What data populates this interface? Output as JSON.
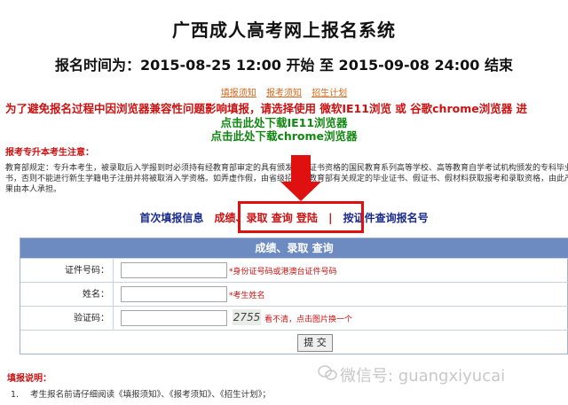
{
  "header": {
    "title": "广西成人高考网上报名系统",
    "time_text": "报名时间为：2015-08-25 12:00 开始  至  2015-09-08 24:00 结束"
  },
  "top_links": [
    "填报须知",
    "报考须知",
    "招生计划"
  ],
  "warning": "为了避免报名过程中因浏览器兼容性问题影响填报，请选择使用  微软IE11浏览  或  谷歌chrome浏览器  进",
  "download_ie": "点击此处下载IE11浏览器",
  "download_chrome": "点击此处下载chrome浏览器",
  "notice": {
    "heading": "报考专升本考生注意：",
    "lines": [
      "教育部规定：专升本考生，被录取后入学报到时必须持有经教育部审定的具有颁发学历证书资格的国民教育系列高等学校、高等教育自学考试机构颁发的专科毕业证书",
      "书，否则不能进行新生学籍电子注册并将被取消入学资格。如弄虚作假，由省级招办按教育部有关规定的毕业证书、假证书、假材料获取报考和录取资格，由此产生的",
      "果由本人承担。"
    ]
  },
  "nav": {
    "first_fill": "首次填报信息",
    "score_login": "成绩、录取  查询  登陆",
    "separator": "|",
    "by_id": "按证件查询报名号"
  },
  "form": {
    "header": "成绩、录取  查询",
    "id_label": "证件号码：",
    "id_hint": "*身份证号码或港澳台证件号码",
    "name_label": "姓名：",
    "name_hint": "*考生姓名",
    "captcha_label": "验证码：",
    "captcha_code": "2755",
    "captcha_hint": "看不清，点击图片换一个",
    "submit_label": "提 交"
  },
  "fill_instructions": {
    "heading": "填报说明：",
    "item1_num": "1.",
    "item1_text": "考生报名前请仔细阅读《填报须知》、《报考须知》、《招生计划》；"
  },
  "watermark": "微信号: guangxiyucai",
  "colors": {
    "accent_red": "#cc1111",
    "panel_blue": "#6d8bc0",
    "link_green": "#118811",
    "nav_blue": "#1a2a8a"
  }
}
